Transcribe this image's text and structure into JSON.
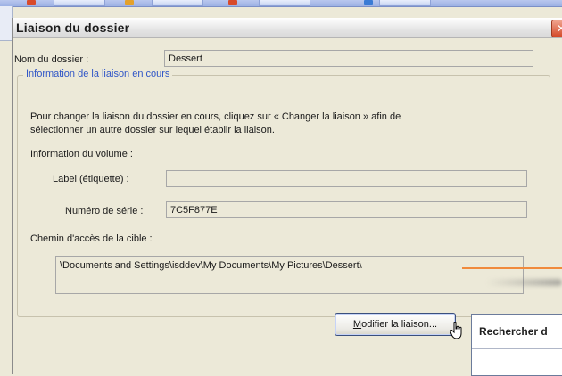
{
  "dialog": {
    "title": "Liaison du dossier",
    "folder_name_label": "Nom du dossier :",
    "folder_name_value": "Dessert",
    "group_title": "Information de la liaison en cours",
    "description_line1": "Pour changer la liaison du dossier en cours, cliquez sur  « Changer la liaison » afin de",
    "description_line2": "sélectionner un autre dossier sur lequel établir la liaison.",
    "volume_info_label": "Information du volume :",
    "volume_label_label": "Label (étiquette) :",
    "volume_label_value": "",
    "serial_label": "Numéro de série :",
    "serial_value": "7C5F877E",
    "target_path_label": "Chemin d'accès de la cible :",
    "target_path_value": "\\Documents and Settings\\isddev\\My Documents\\My Pictures\\Dessert\\",
    "modify_button_mnemonic": "M",
    "modify_button_rest": "odifier la liaison..."
  },
  "side_panel": {
    "title": "Rechercher d"
  },
  "colors": {
    "accent_blue": "#2f55c7",
    "close_red": "#d44a2a",
    "annotation_orange": "#f08a3c"
  }
}
